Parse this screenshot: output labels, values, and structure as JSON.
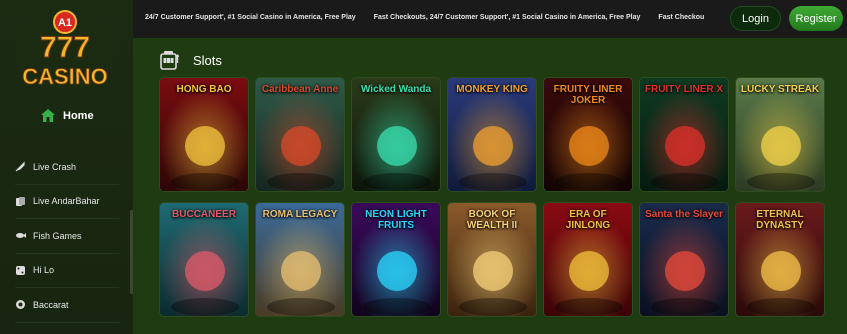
{
  "brand": {
    "logo_top": "A1",
    "logo_digits": "777",
    "logo_word": "CASINO"
  },
  "sidebar": {
    "home_label": "Home",
    "items": [
      {
        "label": "Live Crash",
        "icon": "rocket-icon"
      },
      {
        "label": "Live AndarBahar",
        "icon": "cards-icon"
      },
      {
        "label": "Fish Games",
        "icon": "fish-icon"
      },
      {
        "label": "Hi Lo",
        "icon": "dice-icon"
      },
      {
        "label": "Baccarat",
        "icon": "chips-icon"
      }
    ]
  },
  "topbar": {
    "ticker": [
      "24/7 Customer Support', #1 Social Casino in America, Free Play",
      "Fast Checkouts, 24/7 Customer Support', #1 Social Casino in America, Free Play",
      "Fast Checkou"
    ],
    "login_label": "Login",
    "register_label": "Register"
  },
  "section": {
    "title": "Slots",
    "icon": "slot-machine-icon"
  },
  "games": [
    {
      "title": "HONG BAO",
      "bg1": "#7a0c10",
      "bg2": "#2a0606",
      "accent": "#f3c53d"
    },
    {
      "title": "Caribbean Anne",
      "bg1": "#2f5a4a",
      "bg2": "#14261f",
      "accent": "#d94a2a"
    },
    {
      "title": "Wicked Wanda",
      "bg1": "#2a3a1a",
      "bg2": "#0c1408",
      "accent": "#39e0b0"
    },
    {
      "title": "MONKEY KING",
      "bg1": "#2a3a7a",
      "bg2": "#0f1a3a",
      "accent": "#f0a030"
    },
    {
      "title": "FRUITY LINER JOKER",
      "bg1": "#3a0a0a",
      "bg2": "#120404",
      "accent": "#f08a1a"
    },
    {
      "title": "FRUITY LINER X",
      "bg1": "#0e3a22",
      "bg2": "#051a10",
      "accent": "#e0302a"
    },
    {
      "title": "LUCKY STREAK",
      "bg1": "#5a7a4a",
      "bg2": "#2a3a22",
      "accent": "#f4d34a"
    },
    {
      "title": "BUCCANEER",
      "bg1": "#1f6a72",
      "bg2": "#0b2a2e",
      "accent": "#e05a6a"
    },
    {
      "title": "ROMA LEGACY",
      "bg1": "#3a6a9a",
      "bg2": "#4a3a22",
      "accent": "#e8c070"
    },
    {
      "title": "NEON LIGHT FRUITS",
      "bg1": "#3a0a5a",
      "bg2": "#10041c",
      "accent": "#2ad8ff"
    },
    {
      "title": "BOOK OF WEALTH II",
      "bg1": "#8a5a2a",
      "bg2": "#3a220e",
      "accent": "#f6d27a"
    },
    {
      "title": "ERA OF JINLONG",
      "bg1": "#8a0a12",
      "bg2": "#3a0408",
      "accent": "#f2c23a"
    },
    {
      "title": "Santa the Slayer",
      "bg1": "#1a2a4a",
      "bg2": "#0a1020",
      "accent": "#e84a3a"
    },
    {
      "title": "ETERNAL DYNASTY",
      "bg1": "#6a1a1a",
      "bg2": "#2a0a0a",
      "accent": "#f4c24a"
    }
  ],
  "colors": {
    "accent_green": "#2f9a2a",
    "gold": "#f3b632",
    "red": "#d9281f"
  }
}
